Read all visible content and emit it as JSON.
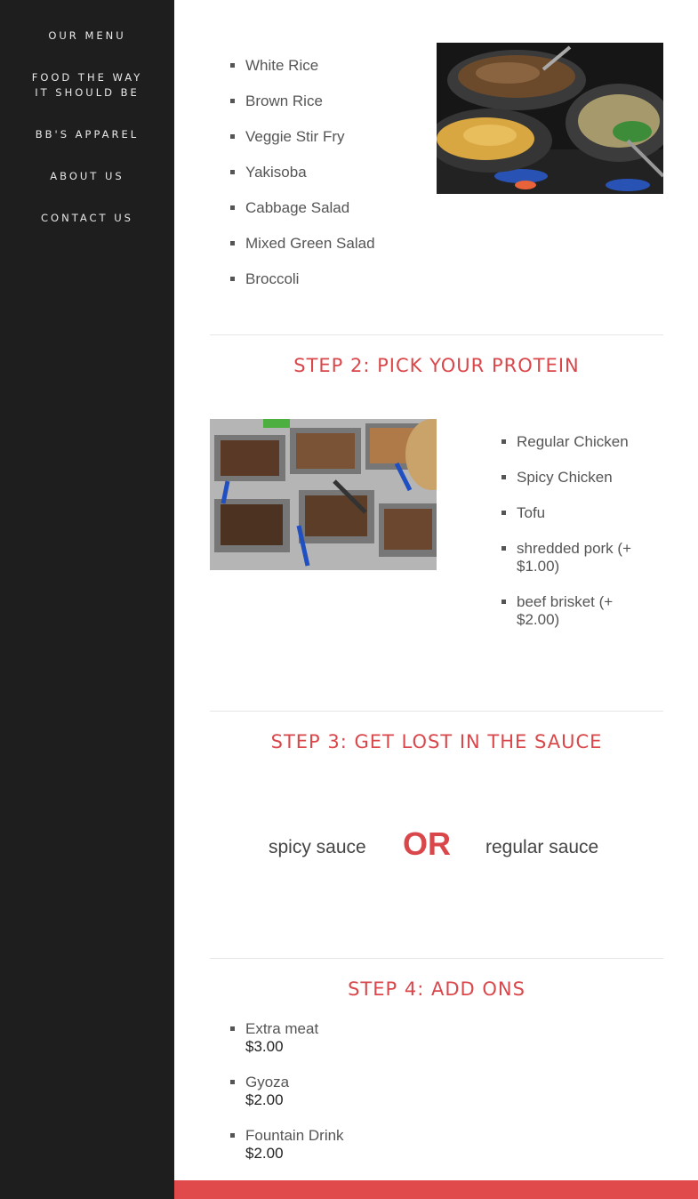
{
  "nav": {
    "items": [
      {
        "label": "OUR MENU"
      },
      {
        "label_line1": "FOOD THE WAY",
        "label_line2": "IT SHOULD BE"
      },
      {
        "label": "BB'S APPAREL"
      },
      {
        "label": "ABOUT US"
      },
      {
        "label": "CONTACT US"
      }
    ]
  },
  "step1": {
    "bases": [
      "White Rice",
      "Brown Rice",
      "Veggie Stir Fry",
      "Yakisoba",
      "Cabbage Salad",
      "Mixed Green Salad",
      "Broccoli"
    ]
  },
  "step2": {
    "heading": "STEP 2: PICK YOUR PROTEIN",
    "proteins": [
      "Regular Chicken",
      "Spicy Chicken",
      "Tofu",
      "shredded pork (+ $1.00)",
      "beef brisket (+ $2.00)"
    ]
  },
  "step3": {
    "heading": "STEP 3: GET LOST IN THE SAUCE",
    "option_a": "spicy sauce",
    "or_text": "OR",
    "option_b": "regular sauce"
  },
  "step4": {
    "heading": "STEP 4: ADD ONS",
    "addons": [
      {
        "name": "Extra meat",
        "price": "$3.00"
      },
      {
        "name": "Gyoza",
        "price": "$2.00"
      },
      {
        "name": "Fountain Drink",
        "price": "$2.00"
      }
    ]
  },
  "colors": {
    "accent": "#d9474b",
    "sidebar": "#1e1e1e",
    "footer": "#e04a4a"
  }
}
